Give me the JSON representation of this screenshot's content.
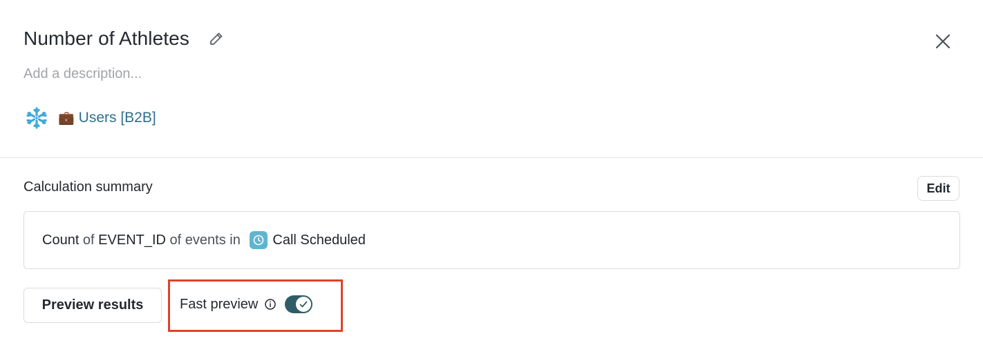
{
  "header": {
    "title": "Number of Athletes",
    "description_placeholder": "Add a description..."
  },
  "source": {
    "warehouse_icon": "snowflake-icon",
    "emoji": "💼",
    "label": "Users [B2B]",
    "link_color": "#2f6f8f"
  },
  "calculation": {
    "title": "Calculation summary",
    "edit_label": "Edit",
    "summary": {
      "aggregation": "Count",
      "of_word": " of ",
      "field": "EVENT_ID",
      "events_phrase": " of events in ",
      "event_icon": "clock-icon",
      "event_name": "Call Scheduled",
      "event_icon_color": "#5fb5cf"
    }
  },
  "controls": {
    "preview_label": "Preview results",
    "fast_preview_label": "Fast preview",
    "fast_preview_enabled": true,
    "toggle_color": "#2f5d67",
    "highlight_color": "#e0412a"
  }
}
